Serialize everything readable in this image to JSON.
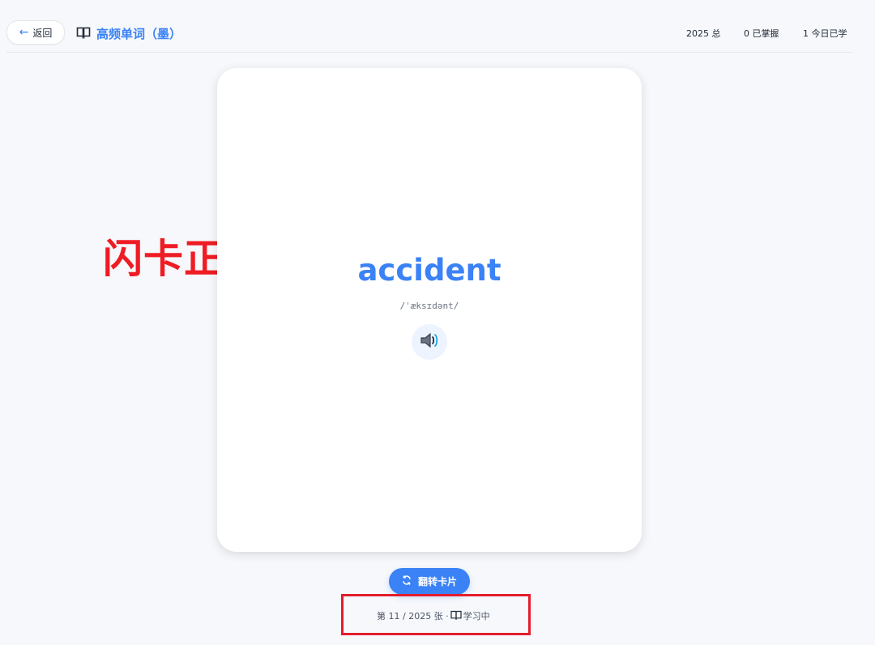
{
  "header": {
    "back_label": "返回",
    "title": "高频单词（墨）",
    "stats": {
      "total": "2025 总",
      "mastered": "0 已掌握",
      "today": "1 今日已学"
    }
  },
  "card": {
    "word": "accident",
    "phonetic": "/ˈæksɪdənt/",
    "audio_icon": "speaker-icon"
  },
  "annotation": {
    "label": "闪卡正面"
  },
  "actions": {
    "flip_label": "翻转卡片",
    "flip_icon": "refresh-icon"
  },
  "progress": {
    "prefix": "第 11 / 2025 张 ·",
    "status": "学习中"
  },
  "colors": {
    "accent": "#3b82f6",
    "annotation": "#ef1c24",
    "page_bg": "#f6f8fb"
  }
}
